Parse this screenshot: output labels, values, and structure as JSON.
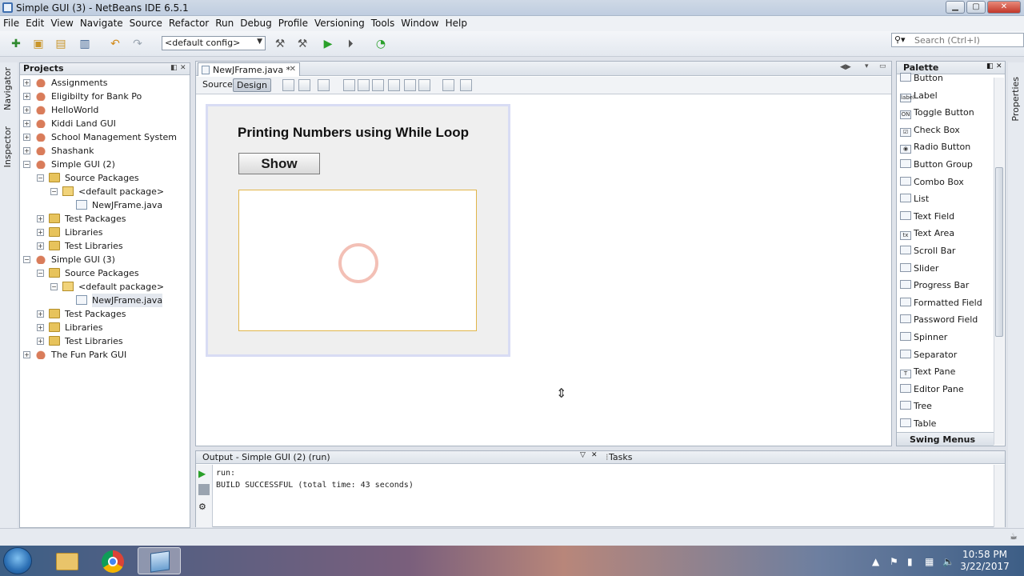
{
  "window": {
    "title": "Simple GUI (3) - NetBeans IDE 6.5.1"
  },
  "menu": [
    "File",
    "Edit",
    "View",
    "Navigate",
    "Source",
    "Refactor",
    "Run",
    "Debug",
    "Profile",
    "Versioning",
    "Tools",
    "Window",
    "Help"
  ],
  "toolbar": {
    "config": "<default config>",
    "search_placeholder": "Search (Ctrl+I)"
  },
  "side_tabs": {
    "navigator": "Navigator",
    "inspector": "Inspector",
    "properties": "Properties"
  },
  "projects": {
    "title": "Projects",
    "tree": [
      {
        "label": "Assignments",
        "kind": "project",
        "level": 0,
        "expanded": false
      },
      {
        "label": "Eligibilty for Bank Po",
        "kind": "project",
        "level": 0,
        "expanded": false
      },
      {
        "label": "HelloWorld",
        "kind": "project",
        "level": 0,
        "expanded": false
      },
      {
        "label": "Kiddi Land GUI",
        "kind": "project",
        "level": 0,
        "expanded": false
      },
      {
        "label": "School Management System",
        "kind": "project",
        "level": 0,
        "expanded": false
      },
      {
        "label": "Shashank",
        "kind": "project",
        "level": 0,
        "expanded": false
      },
      {
        "label": "Simple GUI (2)",
        "kind": "project",
        "level": 0,
        "expanded": true
      },
      {
        "label": "Source Packages",
        "kind": "pkgs",
        "level": 1,
        "expanded": true
      },
      {
        "label": "<default package>",
        "kind": "pkg",
        "level": 2,
        "expanded": true
      },
      {
        "label": "NewJFrame.java",
        "kind": "java",
        "level": 3,
        "expanded": null
      },
      {
        "label": "Test Packages",
        "kind": "pkgs",
        "level": 1,
        "expanded": false
      },
      {
        "label": "Libraries",
        "kind": "pkgs",
        "level": 1,
        "expanded": false
      },
      {
        "label": "Test Libraries",
        "kind": "pkgs",
        "level": 1,
        "expanded": false
      },
      {
        "label": "Simple GUI (3)",
        "kind": "project",
        "level": 0,
        "expanded": true
      },
      {
        "label": "Source Packages",
        "kind": "pkgs",
        "level": 1,
        "expanded": true
      },
      {
        "label": "<default package>",
        "kind": "pkg",
        "level": 2,
        "expanded": true
      },
      {
        "label": "NewJFrame.java",
        "kind": "java",
        "level": 3,
        "expanded": null,
        "selected": true
      },
      {
        "label": "Test Packages",
        "kind": "pkgs",
        "level": 1,
        "expanded": false
      },
      {
        "label": "Libraries",
        "kind": "pkgs",
        "level": 1,
        "expanded": false
      },
      {
        "label": "Test Libraries",
        "kind": "pkgs",
        "level": 1,
        "expanded": false
      },
      {
        "label": "The Fun Park GUI",
        "kind": "project",
        "level": 0,
        "expanded": false
      }
    ]
  },
  "editor": {
    "tab_label": "NewJFrame.java *",
    "source_label": "Source",
    "design_label": "Design",
    "form": {
      "title": "Printing Numbers using While Loop",
      "button": "Show"
    }
  },
  "palette": {
    "title": "Palette",
    "items": [
      "Button",
      "Label",
      "Toggle Button",
      "Check Box",
      "Radio Button",
      "Button Group",
      "Combo Box",
      "List",
      "Text Field",
      "Text Area",
      "Scroll Bar",
      "Slider",
      "Progress Bar",
      "Formatted Field",
      "Password Field",
      "Spinner",
      "Separator",
      "Text Pane",
      "Editor Pane",
      "Tree",
      "Table"
    ],
    "icon_labels": [
      "",
      "label",
      "ON",
      "☑",
      "◉",
      "",
      "",
      "",
      "",
      "tx",
      "",
      "",
      "",
      "",
      "",
      "",
      "",
      "T",
      "",
      "",
      ""
    ],
    "section": "Swing Menus"
  },
  "output": {
    "title": "Output - Simple GUI (2) (run)",
    "tasks_label": "Tasks",
    "lines": [
      "run:",
      "BUILD SUCCESSFUL (total time: 43 seconds)"
    ]
  },
  "taskbar": {
    "time": "10:58 PM",
    "date": "3/22/2017"
  }
}
